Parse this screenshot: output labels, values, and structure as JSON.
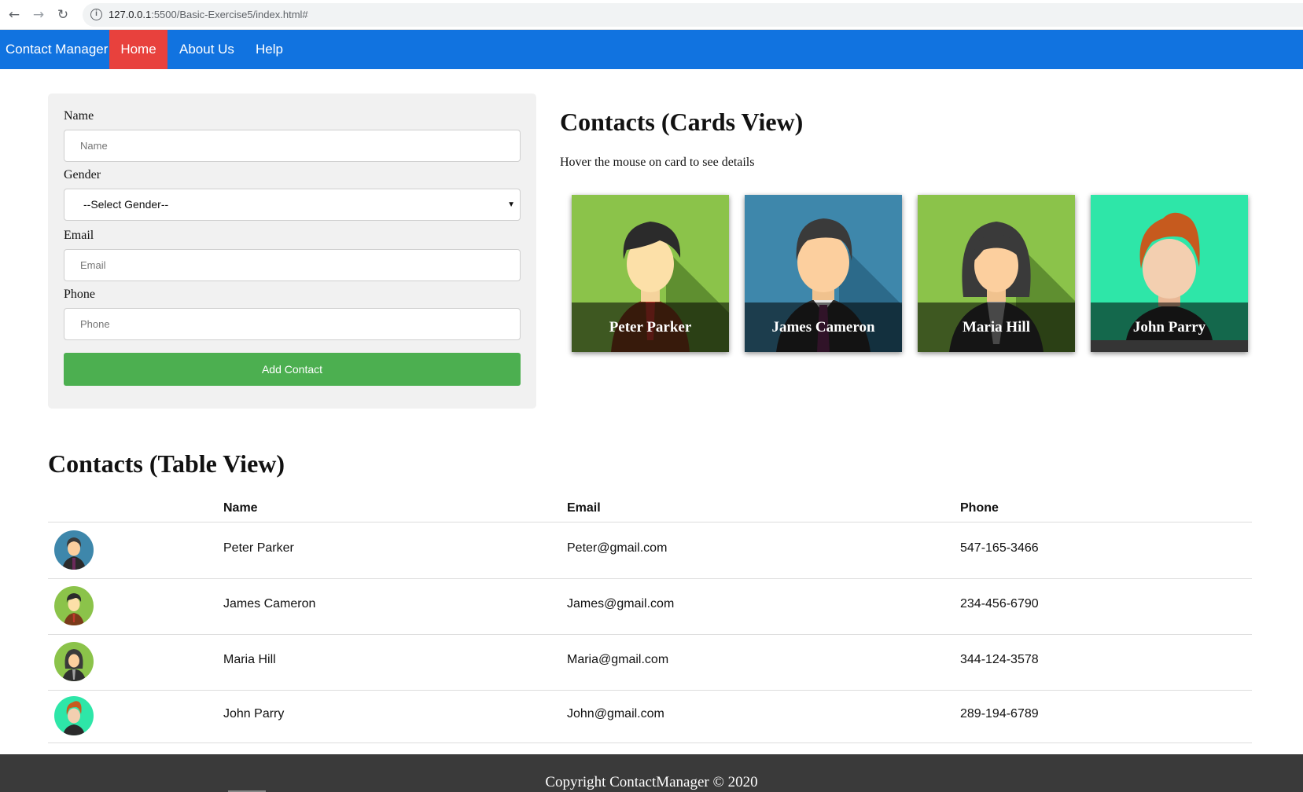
{
  "browser": {
    "url_host": "127.0.0.1",
    "url_path": ":5500/Basic-Exercise5/index.html#",
    "back_icon": "arrow-left-icon",
    "forward_icon": "arrow-right-icon",
    "reload_icon": "reload-icon",
    "site_info_icon": "info-icon"
  },
  "navbar": {
    "brand": "Contact Manager",
    "items": [
      {
        "label": "Home",
        "active": true
      },
      {
        "label": "About Us",
        "active": false
      },
      {
        "label": "Help",
        "active": false
      }
    ],
    "bg_color": "#1173e0",
    "active_color": "#e8413d"
  },
  "form": {
    "name_label": "Name",
    "name_placeholder": "Name",
    "gender_label": "Gender",
    "gender_selected": "--Select Gender--",
    "email_label": "Email",
    "email_placeholder": "Email",
    "phone_label": "Phone",
    "phone_placeholder": "Phone",
    "submit_label": "Add Contact",
    "submit_color": "#4caf50"
  },
  "cards_view": {
    "title": "Contacts (Cards View)",
    "hint": "Hover the mouse on card to see details",
    "cards": [
      {
        "name": "Peter Parker",
        "bg": "#8bc34a"
      },
      {
        "name": "James Cameron",
        "bg": "#3e87ab"
      },
      {
        "name": "Maria Hill",
        "bg": "#8bc34a"
      },
      {
        "name": "John Parry",
        "bg": "#2ee6a8"
      }
    ]
  },
  "table_view": {
    "title": "Contacts (Table View)",
    "columns": [
      "Name",
      "Email",
      "Phone"
    ],
    "rows": [
      {
        "name": "Peter Parker",
        "email": "Peter@gmail.com",
        "phone": "547-165-3466"
      },
      {
        "name": "James Cameron",
        "email": "James@gmail.com",
        "phone": "234-456-6790"
      },
      {
        "name": "Maria Hill",
        "email": "Maria@gmail.com",
        "phone": "344-124-3578"
      },
      {
        "name": "John Parry",
        "email": "John@gmail.com",
        "phone": "289-194-6789"
      }
    ]
  },
  "footer": {
    "text": "Copyright ContactManager © 2020"
  }
}
